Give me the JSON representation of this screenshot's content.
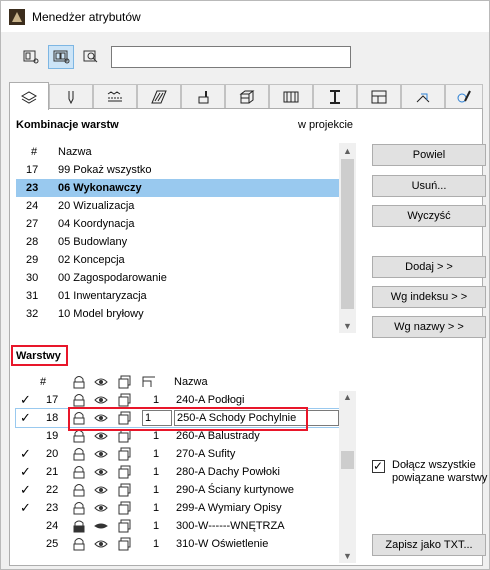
{
  "window": {
    "title": "Menedżer atrybutów"
  },
  "search": {
    "value": "",
    "placeholder": ""
  },
  "top_list": {
    "label": "Kombinacje warstw",
    "view_label": "w projekcie",
    "col_num": "#",
    "col_name": "Nazwa",
    "rows": [
      {
        "num": "17",
        "name": "99 Pokaż wszystko"
      },
      {
        "num": "23",
        "name": "06 Wykonawczy"
      },
      {
        "num": "24",
        "name": "20 Wizualizacja"
      },
      {
        "num": "27",
        "name": "04 Koordynacja"
      },
      {
        "num": "28",
        "name": "05 Budowlany"
      },
      {
        "num": "29",
        "name": "02 Koncepcja"
      },
      {
        "num": "30",
        "name": "00 Zagospodarowanie"
      },
      {
        "num": "31",
        "name": "01 Inwentaryzacja"
      },
      {
        "num": "32",
        "name": "10 Model bryłowy"
      }
    ]
  },
  "bottom_list": {
    "label": "Warstwy",
    "col_num": "#",
    "col_name": "Nazwa",
    "rows": [
      {
        "check": "✓",
        "num": "17",
        "pen": "1",
        "name": "240-A Podłogi"
      },
      {
        "check": "✓",
        "num": "18",
        "pen": "1",
        "name": "250-A Schody Pochylnie"
      },
      {
        "check": "",
        "num": "19",
        "pen": "1",
        "name": "260-A Balustrady"
      },
      {
        "check": "✓",
        "num": "20",
        "pen": "1",
        "name": "270-A Sufity"
      },
      {
        "check": "✓",
        "num": "21",
        "pen": "1",
        "name": "280-A Dachy Powłoki"
      },
      {
        "check": "✓",
        "num": "22",
        "pen": "1",
        "name": "290-A Ściany kurtynowe"
      },
      {
        "check": "✓",
        "num": "23",
        "pen": "1",
        "name": "299-A Wymiary Opisy"
      },
      {
        "check": "",
        "num": "24",
        "pen": "1",
        "name": "300-W------WNĘTRZA"
      },
      {
        "check": "",
        "num": "25",
        "pen": "1",
        "name": "310-W Oświetlenie"
      }
    ]
  },
  "buttons": {
    "new": "Powiel",
    "delete": "Usuń...",
    "clear": "Wyczyść",
    "add": "Dodaj > >",
    "by_index": "Wg indeksu > >",
    "by_name": "Wg nazwy > >",
    "save_txt": "Zapisz jako TXT..."
  },
  "option": {
    "label": "Dołącz wszystkie powiązane warstwy",
    "checked": true
  },
  "colors": {
    "selection": "#99c9ef",
    "highlight": "#e8162a"
  }
}
